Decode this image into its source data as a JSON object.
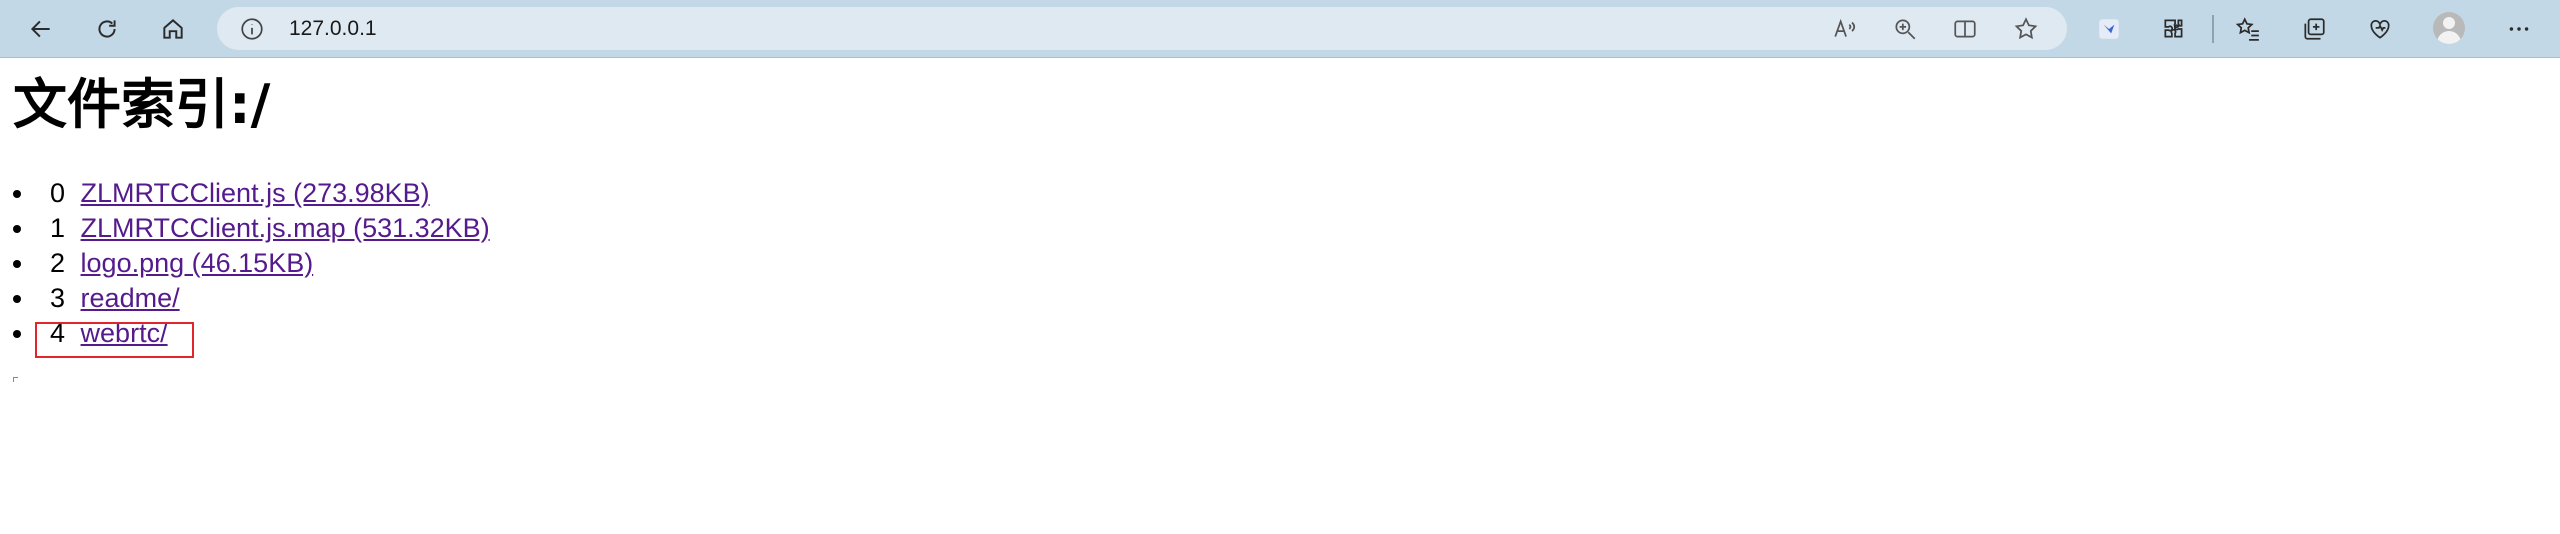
{
  "browser": {
    "url": "127.0.0.1",
    "toolbar_icons": [
      "back-arrow-icon",
      "refresh-icon",
      "home-icon",
      "info-icon",
      "read-aloud-icon",
      "zoom-icon",
      "split-screen-icon",
      "favorite-star-icon",
      "extension-icon",
      "puzzle-icon",
      "favorites-icon",
      "collections-icon",
      "browser-essentials-icon",
      "profile-avatar-icon",
      "more-menu-icon"
    ]
  },
  "page": {
    "title": "文件索引:/",
    "files": [
      {
        "index": "0",
        "link": "ZLMRTCClient.js (273.98KB)"
      },
      {
        "index": "1",
        "link": "ZLMRTCClient.js.map (531.32KB)"
      },
      {
        "index": "2",
        "link": "logo.png (46.15KB)"
      },
      {
        "index": "3",
        "link": "readme/"
      },
      {
        "index": "4",
        "link": "webrtc/"
      }
    ],
    "link_color": "#551a8b",
    "highlight_color": "#e0252b"
  }
}
